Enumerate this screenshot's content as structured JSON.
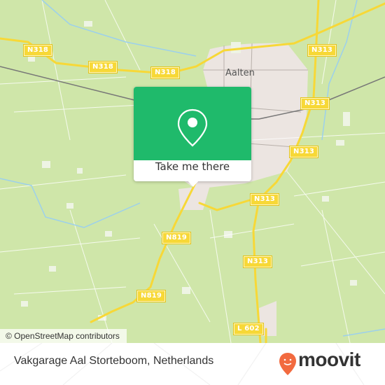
{
  "map": {
    "town_label": "Aalten",
    "road_shields": [
      {
        "id": "n318-west",
        "label": "N318"
      },
      {
        "id": "n318-mid",
        "label": "N318"
      },
      {
        "id": "n318-east",
        "label": "N318"
      },
      {
        "id": "n313-north",
        "label": "N313"
      },
      {
        "id": "n313-rail",
        "label": "N313"
      },
      {
        "id": "n313-south-of-town",
        "label": "N313"
      },
      {
        "id": "n313-junction",
        "label": "N313"
      },
      {
        "id": "n313-south",
        "label": "N313"
      },
      {
        "id": "n819-north",
        "label": "N819"
      },
      {
        "id": "n819-south",
        "label": "N819"
      },
      {
        "id": "l602",
        "label": "L 602"
      }
    ],
    "attribution": "© OpenStreetMap contributors",
    "colors": {
      "land": "#cfe6a9",
      "urban": "#ece5e1",
      "road": "#f7d837",
      "water": "#9cd0ec",
      "rail": "#777777"
    }
  },
  "popup": {
    "action_label": "Take me there",
    "icon": "location-pin-icon",
    "color": "#1fba6b"
  },
  "footer": {
    "place_name": "Vakgarage Aal Storteboom, Netherlands",
    "brand": "moovit",
    "brand_color": "#f26a3f"
  }
}
